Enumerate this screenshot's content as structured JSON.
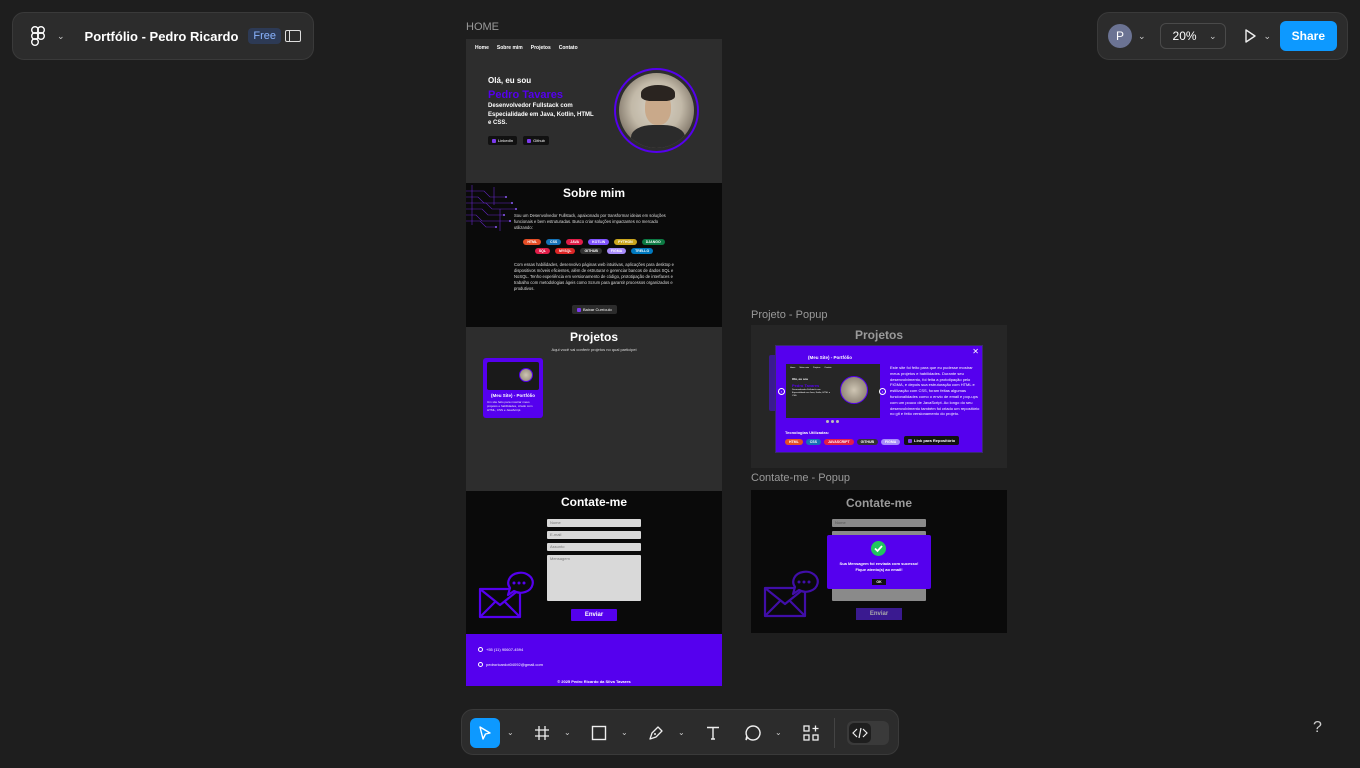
{
  "file_panel": {
    "file_name": "Portfólio - Pedro Ricardo",
    "plan_badge": "Free"
  },
  "right_panel": {
    "avatar_initial": "P",
    "zoom": "20%",
    "share_label": "Share"
  },
  "frames": {
    "home_label": "HOME",
    "projeto_popup_label": "Projeto - Popup",
    "contato_popup_label": "Contate-me - Popup"
  },
  "home": {
    "nav": [
      "Home",
      "Sobre mim",
      "Projetos",
      "Contato"
    ],
    "hero": {
      "greeting": "Olá, eu sou",
      "name": "Pedro Tavares",
      "description": "Desenvolvedor Fullstack com Especialidade em Java, Kotlin, HTML e CSS.",
      "linkedin": "LinkedIn",
      "github": "Github"
    },
    "about": {
      "title": "Sobre mim",
      "paragraph1": "Sou um Desenvolvedor Fullstack, apaixonado por transformar ideias em soluções funcionais e bem estruturadas. Busco criar soluções impactantes no mercado utilizando:",
      "chips_row1": [
        {
          "label": "HTML",
          "color": "#e44d26"
        },
        {
          "label": "CSS",
          "color": "#1572b6"
        },
        {
          "label": "JAVA",
          "color": "#e11d48"
        },
        {
          "label": "KOTLIN",
          "color": "#7f52ff"
        },
        {
          "label": "PYTHON",
          "color": "#caa51d"
        },
        {
          "label": "DJANGO",
          "color": "#0c7a43"
        }
      ],
      "chips_row2": [
        {
          "label": "SQL",
          "color": "#e11d48"
        },
        {
          "label": "MYSQL",
          "color": "#dc2626"
        },
        {
          "label": "GITHUB",
          "color": "#333333"
        },
        {
          "label": "FIGMA",
          "color": "#a78bfa"
        },
        {
          "label": "TRELLO",
          "color": "#0079bf"
        }
      ],
      "paragraph2": "Com essas habilidades, desenvolvo páginas web intuitivas, aplicações para desktop e dispositivos móveis eficientes, além de estruturar e gerenciar bancos de dados SQL e NoSQL. Tenho experiência em versionamento de código, prototipação de interfaces e trabalho com metodologias ágeis como Scrum para garantir processos organizados e produtivos.",
      "cv_button": "Baixar Currículo"
    },
    "projects": {
      "title": "Projetos",
      "subtitle": "Aqui você vai conferir projetos no qual participei",
      "card_title": "(Meu Site) - Portfólio",
      "card_desc": "Um site feito para mostrar meus projetos e habilidades, criado com HTML, CSS e JavaScript."
    },
    "contact": {
      "title": "Contate-me",
      "name_placeholder": "Nome",
      "email_placeholder": "E-mail",
      "subject_placeholder": "Assunto",
      "message_placeholder": "Mensagem",
      "send_label": "Enviar"
    },
    "footer": {
      "phone": "+55 (11) 90607-4594",
      "email": "pedroricardot04092@gmail.com",
      "copyright": "© 2025 Pedro Ricardo da Silva Tavares"
    }
  },
  "projeto_popup": {
    "section_title": "Projetos",
    "close_label": "✕",
    "heading": "(Meu Site) - Portfólio",
    "description": "Este site foi feito para que eu pudesse mostrar meus projetos e habilidades. Durante seu desenvolvimento, foi feita a prototipação pelo FIGMA, e depois sua estruturação com HTML e estilização com CSS, foram feitas algumas funcionalidades como o envio de email e pop-ups com um pouco de JavaScript. Ao longo do seu desenvolvimento também foi criado um repositório no git e feito versionamento do projeto.",
    "tech_title": "Tecnologias Utilizadas:",
    "tech_chips": [
      {
        "label": "HTML",
        "color": "#e44d26"
      },
      {
        "label": "CSS",
        "color": "#1572b6"
      },
      {
        "label": "JAVASCRIPT",
        "color": "#e11d48"
      },
      {
        "label": "GITHUB",
        "color": "#333333"
      },
      {
        "label": "FIGMA",
        "color": "#a78bfa"
      }
    ],
    "repo_button": "Link para Repositório",
    "mini_greeting": "Olá, eu sou"
  },
  "contato_popup": {
    "section_title": "Contate-me",
    "name_placeholder": "Nome",
    "success_line1": "Sua Mensagem foi enviada com sucesso!",
    "success_line2": "Fique atento(a) ao email!",
    "ok_label": "OK",
    "send_label": "Enviar"
  },
  "colors": {
    "accent": "#5500ee",
    "figma_blue": "#0d99ff",
    "canvas": "#1e1e1e"
  },
  "toolbar": {
    "tools": [
      "move-tool",
      "frame-tool",
      "shape-tool",
      "pen-tool",
      "text-tool",
      "comment-tool",
      "actions-tool"
    ],
    "help_label": "?"
  }
}
